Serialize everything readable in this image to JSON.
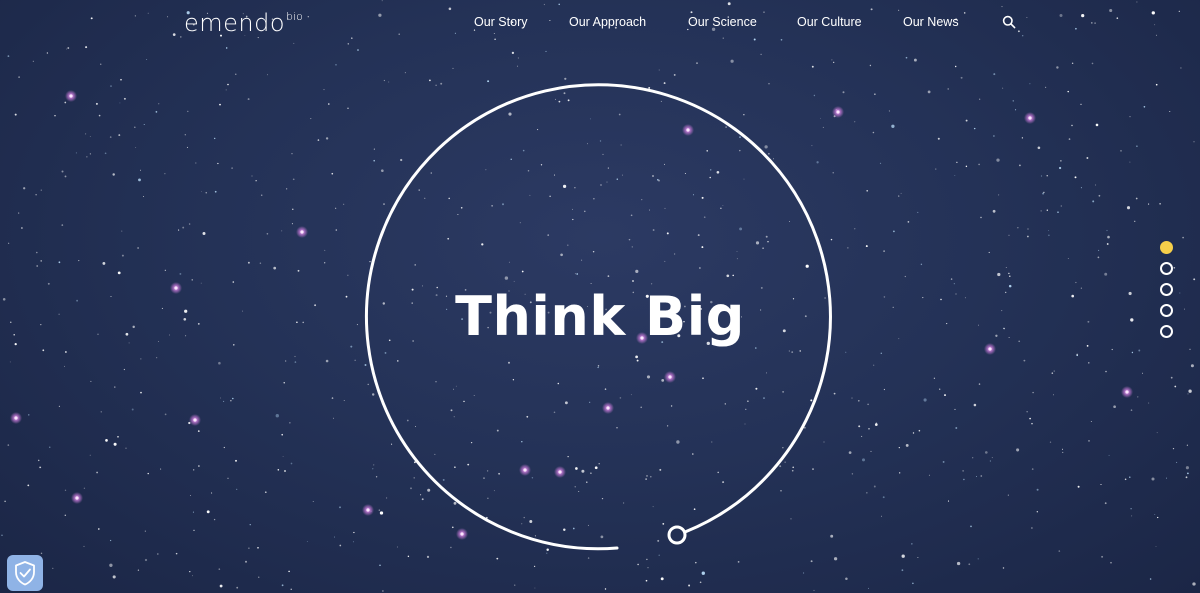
{
  "brand": {
    "name": "emendo",
    "suffix": "bio"
  },
  "nav": {
    "items": [
      {
        "label": "Our Story"
      },
      {
        "label": "Our Approach"
      },
      {
        "label": "Our Science"
      },
      {
        "label": "Our Culture"
      },
      {
        "label": "Our News"
      }
    ],
    "search_icon": "search-icon"
  },
  "hero": {
    "headline": "Think Big"
  },
  "slider": {
    "slide_count": 5,
    "active_index": 0
  },
  "privacy_widget": {
    "icon": "shield-check-icon"
  },
  "colors": {
    "background": "#243257",
    "text": "#ffffff",
    "accent": "#f6cf4a",
    "star_pink": "#d9a0e8",
    "privacy_button": "#8fb3e6"
  }
}
